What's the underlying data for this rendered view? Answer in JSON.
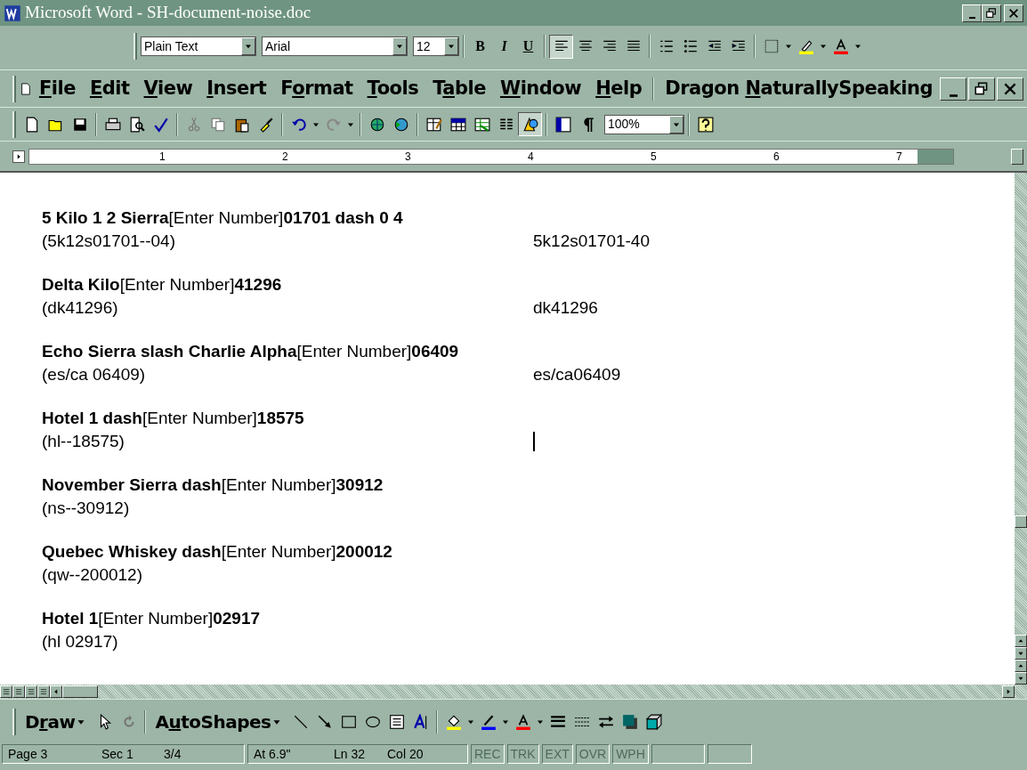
{
  "window": {
    "title": "Microsoft Word - SH-document-noise.doc"
  },
  "formatting_toolbar": {
    "style": "Plain Text",
    "font": "Arial",
    "size": "12",
    "bold": "B",
    "italic": "I",
    "underline": "U",
    "align_buttons": [
      {
        "selected": true
      },
      {
        "selected": false
      },
      {
        "selected": false
      },
      {
        "selected": false
      }
    ]
  },
  "menu_bar": {
    "items": [
      {
        "key": "F",
        "post": "ile"
      },
      {
        "key": "E",
        "post": "dit"
      },
      {
        "key": "V",
        "post": "iew"
      },
      {
        "key": "I",
        "post": "nsert"
      },
      {
        "pre": "F",
        "key": "o",
        "post": "rmat"
      },
      {
        "key": "T",
        "post": "ools"
      },
      {
        "pre": "T",
        "key": "a",
        "post": "ble"
      },
      {
        "key": "W",
        "post": "indow"
      },
      {
        "key": "H",
        "post": "elp"
      },
      {
        "pre": "Dragon ",
        "key": "N",
        "post": "aturallySpeaking"
      }
    ]
  },
  "standard_toolbar": {
    "zoom": "100%",
    "pressed_buttons": [
      {
        "selected": true
      }
    ]
  },
  "ruler": {
    "numbers": [
      "1",
      "2",
      "3",
      "4",
      "5",
      "6",
      "7"
    ]
  },
  "document": {
    "entries": [
      {
        "spoken": "**5 Kilo 1 2 Sierra**[Enter Number]**01701 dash 0 4**",
        "expected": "(5k12s01701--04)",
        "result": "5k12s01701-40"
      },
      {
        "spoken": "**Delta Kilo**[Enter Number]**41296**",
        "expected": "(dk41296)",
        "result": "dk41296"
      },
      {
        "spoken": "**Echo Sierra slash Charlie Alpha**[Enter Number]**06409**",
        "expected": "(es/ca 06409)",
        "result": "es/ca06409"
      },
      {
        "spoken": "**Hotel 1 dash**[Enter Number]**18575**",
        "expected": "(hl--18575)",
        "cursor": true
      },
      {
        "spoken": "**November Sierra dash**[Enter Number]**30912**",
        "expected": "(ns--30912)"
      },
      {
        "spoken": "**Quebec Whiskey dash**[Enter Number]**200012**",
        "expected": "(qw--200012)"
      },
      {
        "spoken": "**Hotel 1**[Enter Number]**02917**",
        "expected": "(hl 02917)"
      }
    ]
  },
  "drawing_toolbar": {
    "draw": {
      "pre": "D",
      "key": "r",
      "post": "aw"
    },
    "autoshapes": {
      "pre": "A",
      "key": "u",
      "post": "toShapes"
    }
  },
  "status_bar": {
    "fields": [
      {
        "text": "Page 3",
        "disabled": false
      },
      {
        "text": "Sec 1",
        "disabled": false
      },
      {
        "text": "3/4",
        "disabled": false
      },
      {
        "text": "At 6.9\"",
        "disabled": false
      },
      {
        "text": "Ln 32",
        "disabled": false
      },
      {
        "text": "Col 20",
        "disabled": false
      },
      {
        "text": "REC",
        "disabled": true
      },
      {
        "text": "TRK",
        "disabled": true
      },
      {
        "text": "EXT",
        "disabled": true
      },
      {
        "text": "OVR",
        "disabled": true
      },
      {
        "text": "WPH",
        "disabled": true
      }
    ]
  }
}
